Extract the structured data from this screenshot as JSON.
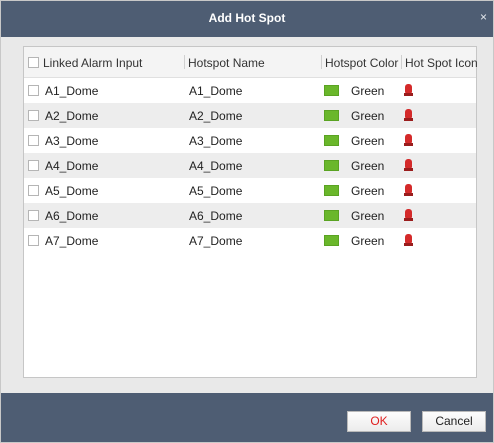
{
  "dialog": {
    "title": "Add Hot Spot",
    "close_label": "×"
  },
  "columns": {
    "linked_alarm_input": "Linked Alarm Input",
    "hotspot_name": "Hotspot Name",
    "hotspot_color": "Hotspot Color",
    "hotspot_icon": "Hot Spot Icon"
  },
  "rows": [
    {
      "alarm_input": "A1_Dome",
      "hotspot_name": "A1_Dome",
      "color_label": "Green",
      "checked": false
    },
    {
      "alarm_input": "A2_Dome",
      "hotspot_name": "A2_Dome",
      "color_label": "Green",
      "checked": false
    },
    {
      "alarm_input": "A3_Dome",
      "hotspot_name": "A3_Dome",
      "color_label": "Green",
      "checked": false
    },
    {
      "alarm_input": "A4_Dome",
      "hotspot_name": "A4_Dome",
      "color_label": "Green",
      "checked": false
    },
    {
      "alarm_input": "A5_Dome",
      "hotspot_name": "A5_Dome",
      "color_label": "Green",
      "checked": false
    },
    {
      "alarm_input": "A6_Dome",
      "hotspot_name": "A6_Dome",
      "color_label": "Green",
      "checked": false
    },
    {
      "alarm_input": "A7_Dome",
      "hotspot_name": "A7_Dome",
      "color_label": "Green",
      "checked": false
    }
  ],
  "icons": {
    "hotspot_icon": "red-alarm-light-icon"
  },
  "colors": {
    "titlebar": "#4e5d73",
    "swatch_green": "#6ab72b",
    "ok_text": "#e02020"
  },
  "buttons": {
    "ok": "OK",
    "cancel": "Cancel"
  }
}
